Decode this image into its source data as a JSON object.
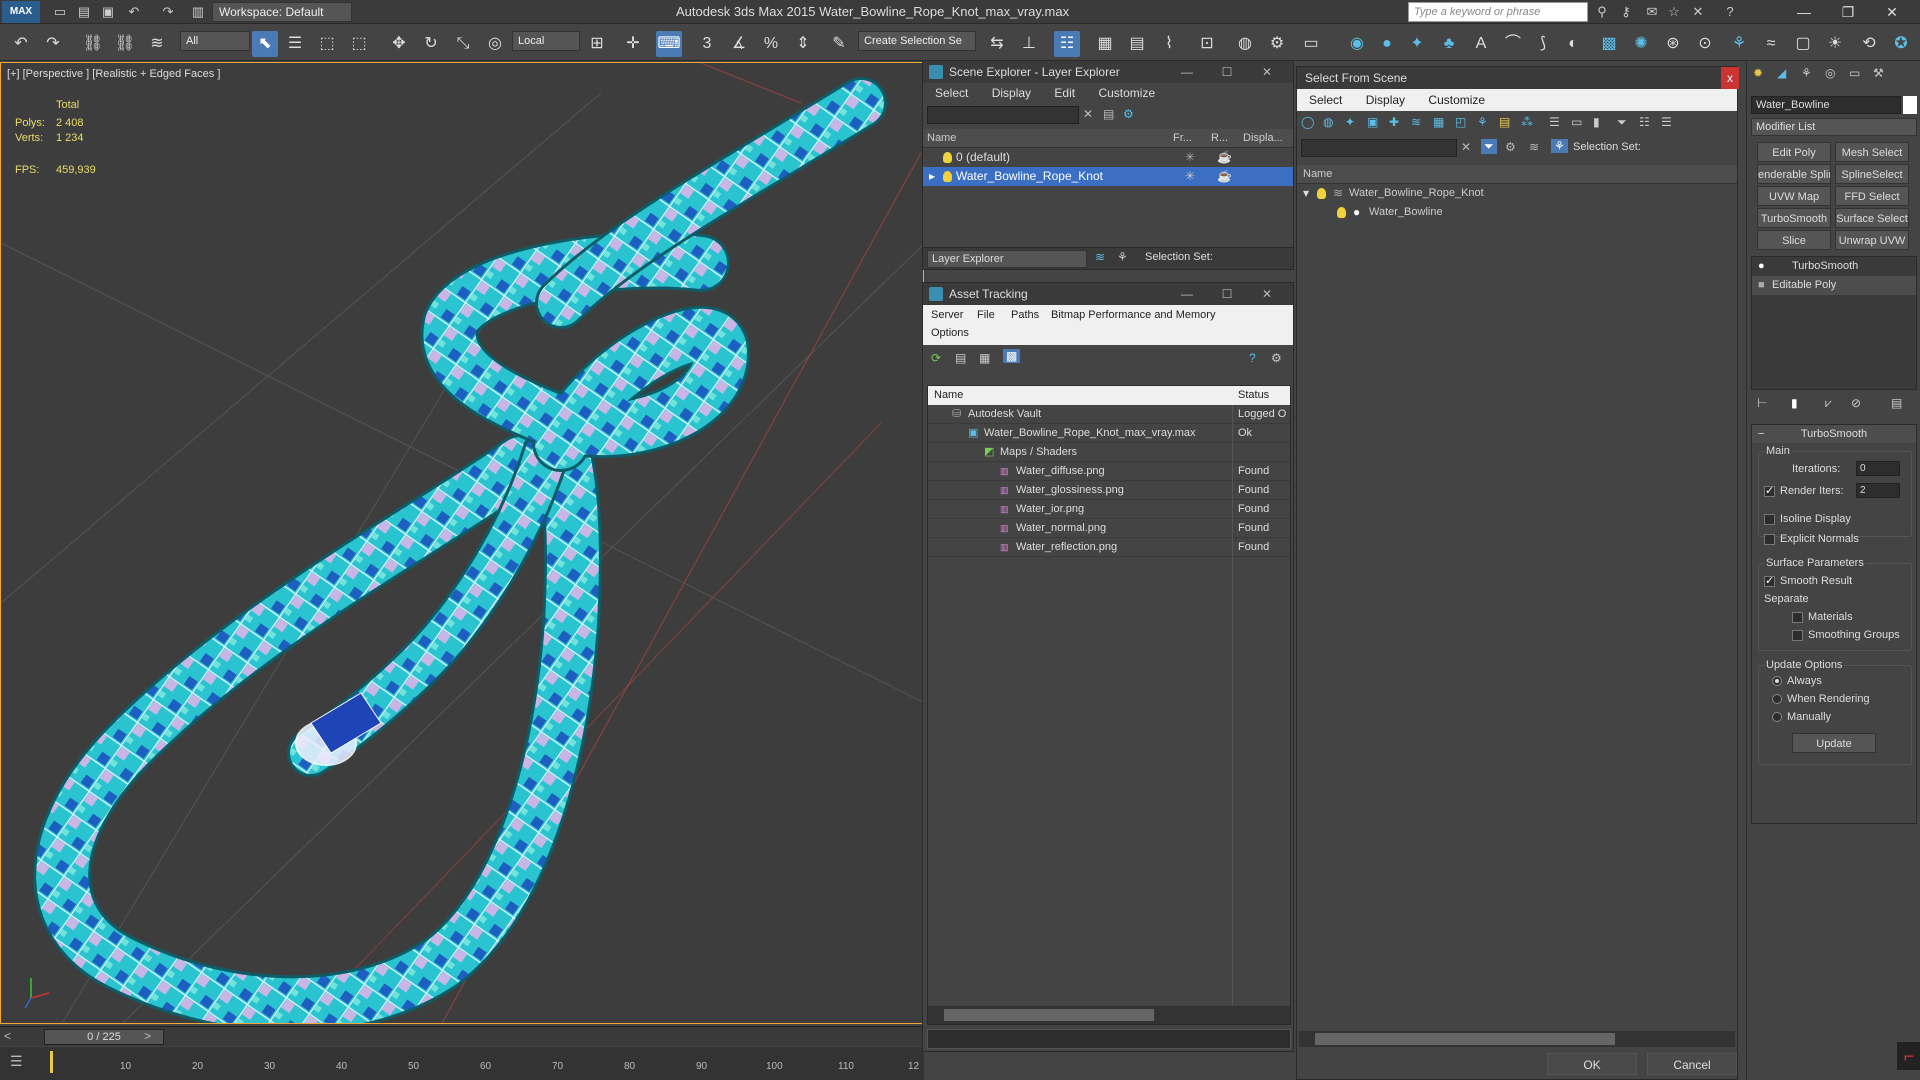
{
  "app": {
    "logo": "MAX",
    "title": "Autodesk 3ds Max  2015      Water_Bowline_Rope_Knot_max_vray.max",
    "workspace": "Workspace: Default",
    "search_placeholder": "Type a keyword or phrase"
  },
  "toolbar": {
    "filter": "All",
    "coord": "Local",
    "selection_set": "Create Selection Se"
  },
  "viewport": {
    "label": "[+] [Perspective ] [Realistic + Edged Faces ]",
    "total_label": "Total",
    "polys_label": "Polys:",
    "polys": "2 408",
    "verts_label": "Verts:",
    "verts": "1 234",
    "fps_label": "FPS:",
    "fps": "459,939"
  },
  "timeline": {
    "slider": "0 / 225",
    "ticks": [
      "10",
      "20",
      "30",
      "40",
      "50",
      "60",
      "70",
      "80",
      "90",
      "100",
      "110",
      "12"
    ]
  },
  "scene_explorer": {
    "title": "Scene Explorer - Layer Explorer",
    "menu": [
      "Select",
      "Display",
      "Edit",
      "Customize"
    ],
    "columns": [
      "Name",
      "Fr...",
      "R...",
      "Displa..."
    ],
    "rows": [
      "0 (default)",
      "Water_Bowline_Rope_Knot"
    ],
    "footer_label": "Layer Explorer",
    "selection_set": "Selection Set:"
  },
  "asset_tracking": {
    "title": "Asset Tracking",
    "menu": [
      "Server",
      "File",
      "Paths",
      "Bitmap Performance and Memory",
      "Options"
    ],
    "columns": [
      "Name",
      "Status"
    ],
    "rows": [
      {
        "name": "Autodesk Vault",
        "status": "Logged O"
      },
      {
        "name": "Water_Bowline_Rope_Knot_max_vray.max",
        "status": "Ok"
      },
      {
        "name": "Maps / Shaders",
        "status": ""
      },
      {
        "name": "Water_diffuse.png",
        "status": "Found"
      },
      {
        "name": "Water_glossiness.png",
        "status": "Found"
      },
      {
        "name": "Water_ior.png",
        "status": "Found"
      },
      {
        "name": "Water_normal.png",
        "status": "Found"
      },
      {
        "name": "Water_reflection.png",
        "status": "Found"
      }
    ]
  },
  "select_from_scene": {
    "title": "Select From Scene",
    "menu": [
      "Select",
      "Display",
      "Customize"
    ],
    "selection_set": "Selection Set:",
    "column": "Name",
    "tree": [
      "Water_Bowline_Rope_Knot",
      "Water_Bowline"
    ],
    "ok": "OK",
    "cancel": "Cancel"
  },
  "command_panel": {
    "object_name": "Water_Bowline",
    "modifier_list": "Modifier List",
    "buttons": [
      "Edit Poly",
      "Mesh Select",
      "enderable Splin",
      "SplineSelect",
      "UVW Map",
      "FFD Select",
      "TurboSmooth",
      "Surface Select",
      "Slice",
      "Unwrap UVW"
    ],
    "stack": [
      "TurboSmooth",
      "Editable Poly"
    ],
    "rollout_title": "TurboSmooth",
    "main_label": "Main",
    "iterations_label": "Iterations:",
    "iterations": "0",
    "render_iters_label": "Render Iters:",
    "render_iters": "2",
    "isoline": "Isoline Display",
    "explicit_normals": "Explicit Normals",
    "surface_params": "Surface Parameters",
    "smooth_result": "Smooth Result",
    "separate": "Separate",
    "materials": "Materials",
    "smoothing_groups": "Smoothing Groups",
    "update_options": "Update Options",
    "always": "Always",
    "when_rendering": "When Rendering",
    "manually": "Manually",
    "update": "Update"
  }
}
